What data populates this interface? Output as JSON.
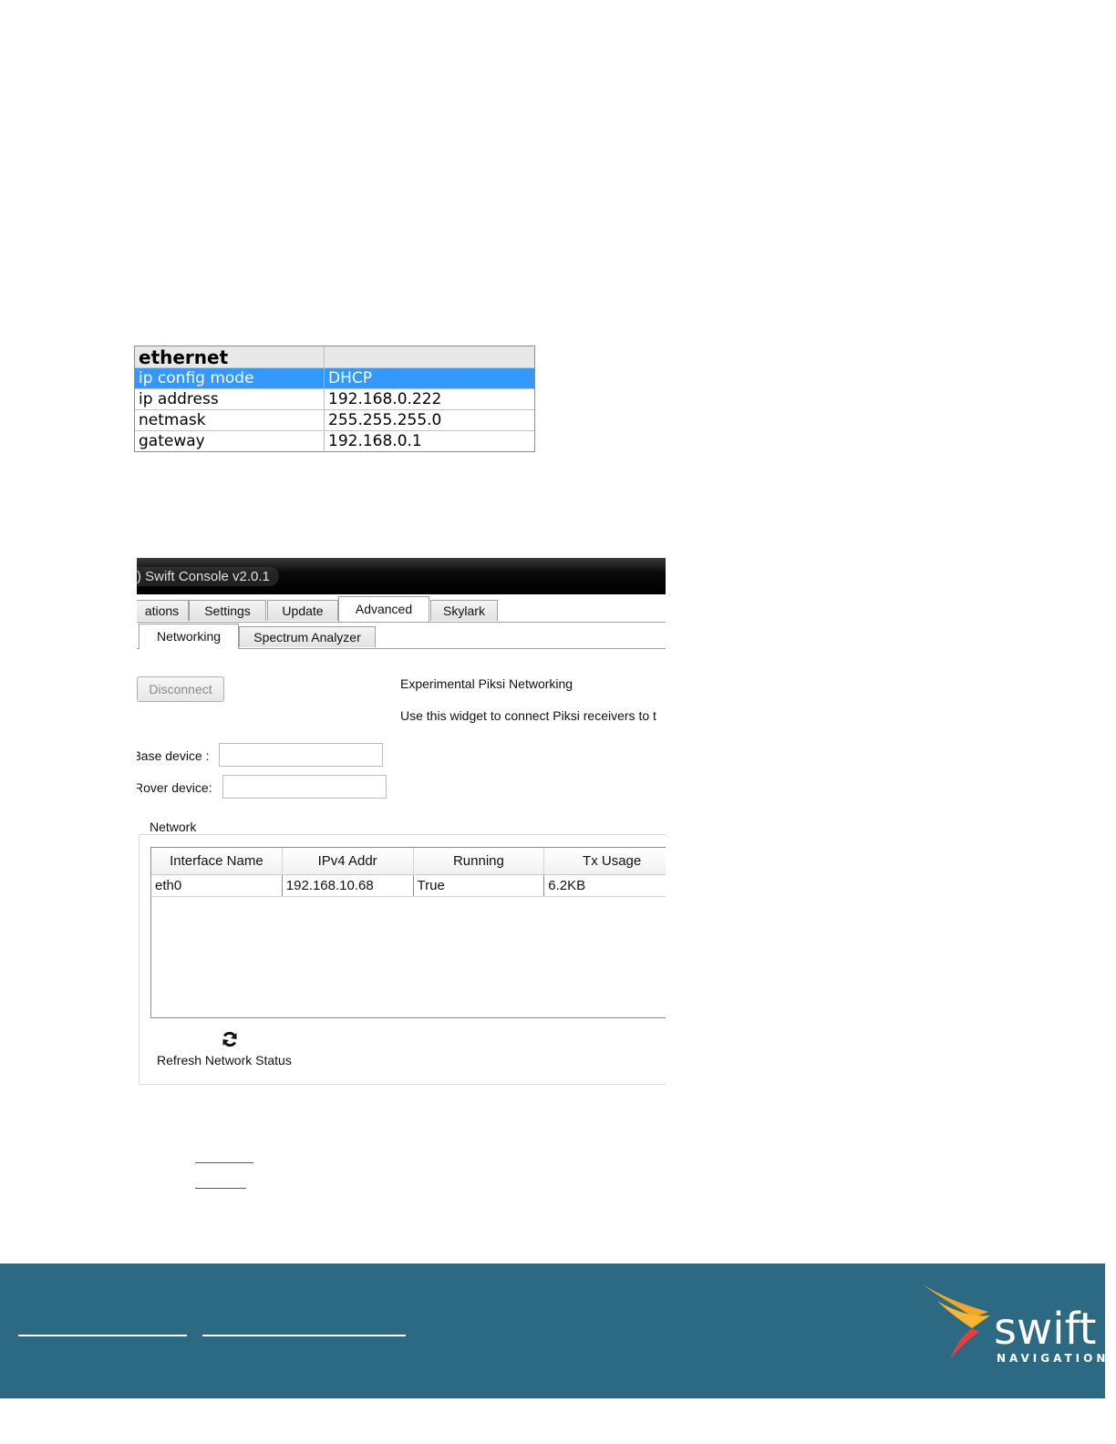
{
  "ethernet_table": {
    "header": "ethernet",
    "rows": [
      {
        "name": "ip config mode",
        "value": "DHCP",
        "selected": true
      },
      {
        "name": "ip address",
        "value": "192.168.0.222"
      },
      {
        "name": "netmask",
        "value": "255.255.255.0"
      },
      {
        "name": "gateway",
        "value": "192.168.0.1"
      }
    ]
  },
  "console": {
    "title": ") Swift Console v2.0.1",
    "main_tabs": [
      "ations",
      "Settings",
      "Update",
      "Advanced",
      "Skylark"
    ],
    "active_main_tab": "Advanced",
    "sub_tabs": [
      "Networking",
      "Spectrum Analyzer"
    ],
    "active_sub_tab": "Networking",
    "disconnect_label": "Disconnect",
    "info_title": "Experimental Piksi Networking",
    "info_text": "Use this widget to connect Piksi receivers to t",
    "base_device_label": "3ase device :",
    "base_device_value": "",
    "rover_device_label": "Rover device:",
    "rover_device_value": "",
    "network_group_label": "Network",
    "network_table": {
      "columns": [
        "Interface Name",
        "IPv4 Addr",
        "Running",
        "Tx Usage"
      ],
      "rows": [
        [
          "eth0",
          "192.168.10.68",
          "True",
          "6.2KB"
        ]
      ]
    },
    "refresh_icon": "refresh-icon",
    "refresh_label": "Refresh Network Status"
  },
  "footer": {
    "background": "#2c6a83",
    "logo_word": "swift",
    "logo_sub": "NAVIGATION"
  }
}
